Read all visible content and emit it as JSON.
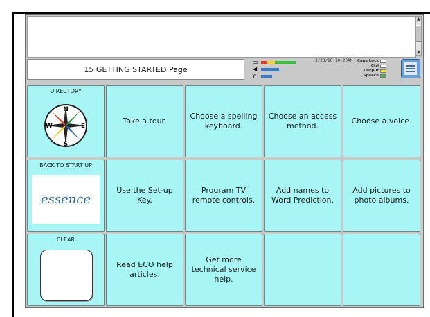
{
  "status": {
    "page_title": "15 GETTING STARTED Page",
    "datetime": "3/23/10 10:20AM",
    "indicators": [
      "Caps Lock",
      "Ctrl",
      "Output",
      "Speech"
    ]
  },
  "grid": {
    "directory_label": "DIRECTORY",
    "back_label": "BACK TO START UP",
    "essence_text": "essence",
    "clear_label": "CLEAR",
    "buttons": [
      "Take a tour.",
      "Choose a spelling keyboard.",
      "Choose an access method.",
      "Choose a voice.",
      "Use the Set-up Key.",
      "Program TV remote controls.",
      "Add names to Word Prediction.",
      "Add pictures to photo albums.",
      "Read ECO help articles.",
      "Get more technical service help."
    ]
  },
  "colors": {
    "key_background": "#a8f5f5",
    "device_background": "#c9c9c9"
  },
  "icons": [
    "compass-icon",
    "essence-logo",
    "speaker-icon",
    "headphones-icon",
    "menu-icon"
  ]
}
